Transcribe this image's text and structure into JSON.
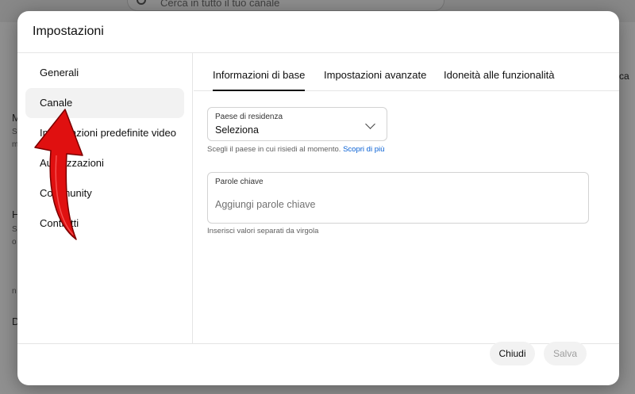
{
  "background": {
    "search_placeholder": "Cerca in tutto il tuo canale",
    "right_cut_text": "a ca",
    "left_letters": [
      "M",
      "S",
      "m",
      "H",
      "S",
      "o",
      "n",
      "D"
    ]
  },
  "dialog": {
    "title": "Impostazioni",
    "sidebar": {
      "items": [
        {
          "label": "Generali",
          "active": false
        },
        {
          "label": "Canale",
          "active": true
        },
        {
          "label": "Impostazioni predefinite video",
          "active": false
        },
        {
          "label": "Autorizzazioni",
          "active": false
        },
        {
          "label": "Community",
          "active": false
        },
        {
          "label": "Contratti",
          "active": false
        }
      ]
    },
    "tabs": [
      {
        "label": "Informazioni di base",
        "active": true
      },
      {
        "label": "Impostazioni avanzate",
        "active": false
      },
      {
        "label": "Idoneità alle funzionalità",
        "active": false
      }
    ],
    "country": {
      "label": "Paese di residenza",
      "value": "Seleziona",
      "hint": "Scegli il paese in cui risiedi al momento.",
      "hint_link": "Scopri di più"
    },
    "keywords": {
      "label": "Parole chiave",
      "placeholder": "Aggiungi parole chiave",
      "hint": "Inserisci valori separati da virgola"
    },
    "buttons": {
      "close": "Chiudi",
      "save": "Salva"
    }
  },
  "colors": {
    "accent_link": "#065fd4",
    "arrow_red": "#e01010"
  }
}
